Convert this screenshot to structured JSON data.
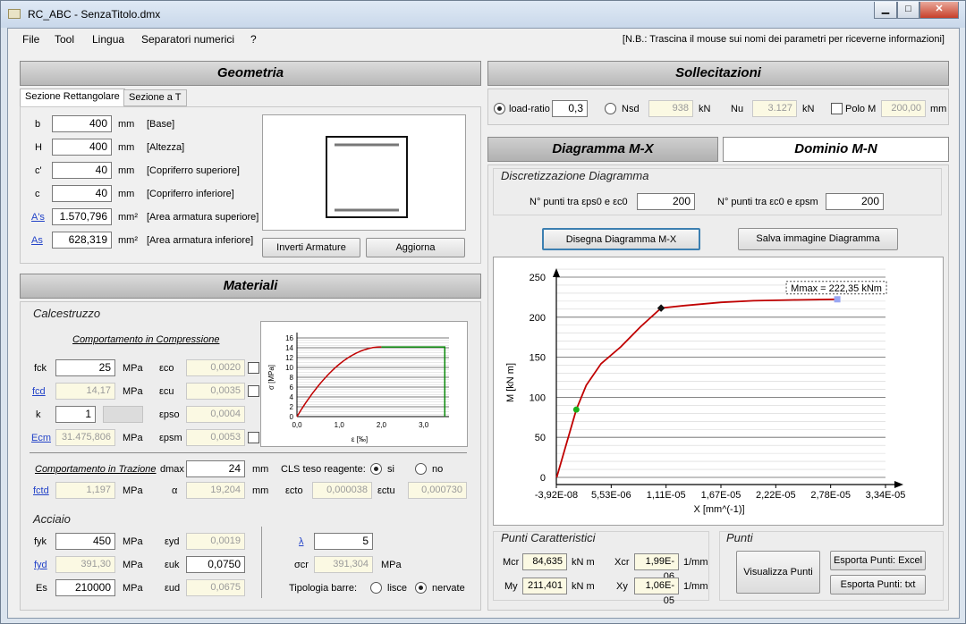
{
  "window": {
    "title": "RC_ABC - SenzaTitolo.dmx",
    "minimize": "▁",
    "maximize": "□",
    "close": "✕"
  },
  "menu": [
    "File",
    "Tool",
    "Lingua",
    "Separatori numerici",
    "?"
  ],
  "note": "[N.B.: Trascina il mouse sui nomi dei parametri per riceverne informazioni]",
  "geometria": {
    "title": "Geometria",
    "tabs": [
      "Sezione Rettangolare",
      "Sezione a T"
    ],
    "rows": [
      {
        "label": "b",
        "value": "400",
        "unit": "mm",
        "desc": "[Base]"
      },
      {
        "label": "H",
        "value": "400",
        "unit": "mm",
        "desc": "[Altezza]"
      },
      {
        "label": "c'",
        "value": "40",
        "unit": "mm",
        "desc": "[Copriferro superiore]"
      },
      {
        "label": "c",
        "value": "40",
        "unit": "mm",
        "desc": "[Copriferro inferiore]"
      },
      {
        "label": "A's",
        "value": "1.570,796",
        "unit": "mm²",
        "desc": "[Area armatura superiore]"
      },
      {
        "label": "As",
        "value": "628,319",
        "unit": "mm²",
        "desc": "[Area armatura inferiore]"
      }
    ],
    "btn_inverti": "Inverti Armature",
    "btn_aggiorna": "Aggiorna"
  },
  "materiali": {
    "title": "Materiali",
    "calcestruzzo": "Calcestruzzo",
    "comp_title": "Comportamento in Compressione",
    "fck": {
      "label": "fck",
      "value": "25",
      "unit": "MPa"
    },
    "fcd": {
      "label": "fcd",
      "value": "14,17",
      "unit": "MPa"
    },
    "k": {
      "label": "k",
      "value": "1"
    },
    "ecm": {
      "label": "Ecm",
      "value": "31.475,806",
      "unit": "MPa"
    },
    "eco": {
      "label": "εco",
      "value": "0,0020"
    },
    "ecu": {
      "label": "εcu",
      "value": "0,0035"
    },
    "epso": {
      "label": "εpso",
      "value": "0,0004"
    },
    "epsm": {
      "label": "εpsm",
      "value": "0,0053"
    },
    "traz_title": "Comportamento in Trazione",
    "dmax": {
      "label": "dmax",
      "value": "24",
      "unit": "mm"
    },
    "cls_label": "CLS teso reagente:",
    "si": "si",
    "no": "no",
    "fctd": {
      "label": "fctd",
      "value": "1,197",
      "unit": "MPa"
    },
    "alpha": {
      "label": "α",
      "value": "19,204",
      "unit": "mm"
    },
    "ecto": {
      "label": "εcto",
      "value": "0,000038"
    },
    "ectu": {
      "label": "εctu",
      "value": "0,000730"
    },
    "acciaio": "Acciaio",
    "fyk": {
      "label": "fyk",
      "value": "450",
      "unit": "MPa"
    },
    "fyd": {
      "label": "fyd",
      "value": "391,30",
      "unit": "MPa"
    },
    "es": {
      "label": "Es",
      "value": "210000",
      "unit": "MPa"
    },
    "eyd": {
      "label": "εyd",
      "value": "0,0019"
    },
    "euk": {
      "label": "εuk",
      "value": "0,0750"
    },
    "eud": {
      "label": "εud",
      "value": "0,0675"
    },
    "lambda": {
      "label": "λ",
      "value": "5"
    },
    "scr": {
      "label": "σcr",
      "value": "391,304",
      "unit": "MPa"
    },
    "tipologia": "Tipologia barre:",
    "lisce": "lisce",
    "nervate": "nervate"
  },
  "sollecitazioni": {
    "title": "Sollecitazioni",
    "loadratio_label": "load-ratio",
    "loadratio": "0,3",
    "nsd_label": "Nsd",
    "nsd": "938",
    "nu_label": "Nu",
    "nu": "3.127",
    "kn": "kN",
    "polo_label": "Polo M",
    "polo": "200,00",
    "mm": "mm"
  },
  "tabs2": {
    "mx": "Diagramma M-X",
    "mn": "Dominio M-N"
  },
  "discretizzazione": {
    "title": "Discretizzazione Diagramma",
    "p1_label": "N° punti tra εps0 e εc0",
    "p1": "200",
    "p2_label": "N° punti tra εc0 e εpsm",
    "p2": "200",
    "btn_disegna": "Disegna Diagramma M-X",
    "btn_salva": "Salva immagine Diagramma"
  },
  "punti_car": {
    "title": "Punti Caratteristici",
    "mcr_label": "Mcr",
    "mcr": "84,635",
    "mcr_unit": "kN m",
    "my_label": "My",
    "my": "211,401",
    "my_unit": "kN m",
    "xcr_label": "Xcr",
    "xcr": "1,99E-06",
    "xcr_unit": "1/mm",
    "xy_label": "Xy",
    "xy": "1,06E-05",
    "xy_unit": "1/mm"
  },
  "punti": {
    "title": "Punti",
    "btn_visualizza": "Visualizza Punti",
    "btn_excel": "Esporta Punti: Excel",
    "btn_txt": "Esporta Punti: txt"
  },
  "small_chart": {
    "ylabel": "σ [MPa]",
    "xlabel": "ε [‰]",
    "yticks": [
      "16",
      "14",
      "12",
      "10",
      "8",
      "6",
      "4",
      "2",
      "0"
    ],
    "xticks": [
      "0,0",
      "1,0",
      "2,0",
      "3,0"
    ]
  },
  "chart_data": {
    "type": "line",
    "xlabel": "X [mm^(-1)]",
    "ylabel": "M [kN m]",
    "xticks": [
      "-3,92E-08",
      "5,53E-06",
      "1,11E-05",
      "1,67E-05",
      "2,22E-05",
      "2,78E-05",
      "3,34E-05"
    ],
    "yticks": [
      "250",
      "200",
      "150",
      "100",
      "50",
      "0"
    ],
    "xlim": [
      -3.92e-08,
      3.34e-05
    ],
    "ylim": [
      0,
      250
    ],
    "series": [
      {
        "x": [
          0,
          1.99e-06,
          3e-06,
          4.5e-06,
          6.5e-06,
          8.5e-06,
          1.06e-05,
          1.3e-05,
          1.67e-05,
          2e-05,
          2.4e-05,
          2.85e-05
        ],
        "y": [
          0,
          84.635,
          115,
          142,
          163,
          188,
          211.401,
          214.5,
          218.5,
          220.5,
          221.5,
          222.35
        ],
        "color": "#c00000"
      }
    ],
    "markers": {
      "cracking": [
        1.99e-06,
        84.635
      ],
      "yield": [
        1.06e-05,
        211.401
      ],
      "max": [
        2.85e-05,
        222.35
      ]
    },
    "annotation": "Mmax = 222,35 kNm"
  }
}
